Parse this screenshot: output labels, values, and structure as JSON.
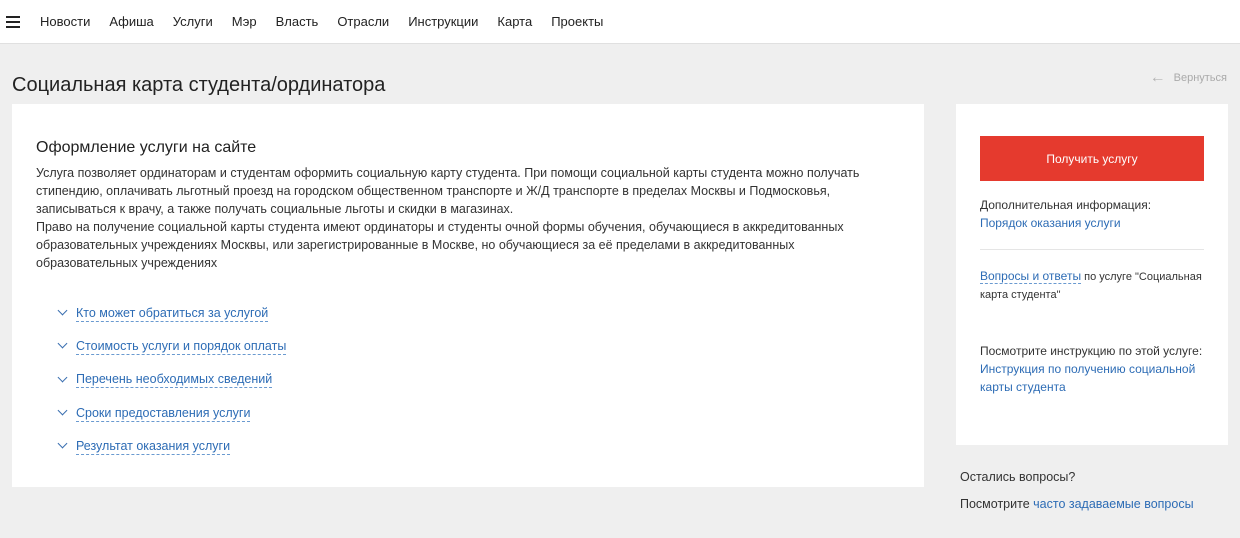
{
  "nav": {
    "items": [
      "Новости",
      "Афиша",
      "Услуги",
      "Мэр",
      "Власть",
      "Отрасли",
      "Инструкции",
      "Карта",
      "Проекты"
    ]
  },
  "page": {
    "title": "Социальная карта студента/ординатора",
    "back_label": "Вернуться"
  },
  "main": {
    "section_title": "Оформление услуги на сайте",
    "description": [
      "Услуга позволяет ординаторам и студентам оформить социальную карту студента. При помощи социальной карты студента можно получать",
      "стипендию, оплачивать льготный проезд на городском общественном транспорте и Ж/Д транспорте в пределах Москвы и Подмосковья,",
      "записываться к врачу, а также получать социальные льготы и скидки в магазинах.",
      "Право на получение социальной карты студента имеют ординаторы и студенты очной формы обучения, обучающиеся в аккредитованных",
      "образовательных учреждениях Москвы, или зарегистрированные в Москве, но обучающиеся за её пределами в аккредитованных",
      "образовательных учреждениях"
    ],
    "accordion": [
      "Кто может обратиться за услугой",
      "Стоимость услуги и порядок оплаты",
      "Перечень необходимых сведений",
      "Сроки предоставления услуги",
      "Результат оказания услуги"
    ]
  },
  "side": {
    "cta_label": "Получить услугу",
    "extra_info_label": "Дополнительная информация:",
    "order_link": "Порядок оказания услуги",
    "qa_link": "Вопросы и ответы",
    "qa_suffix": " по услуге \"Социальная",
    "qa_suffix2": "карта студента\"",
    "instruction_label": "Посмотрите инструкцию по этой услуге:",
    "instruction_link_1": "Инструкция по получению социальной",
    "instruction_link_2": "карты студента"
  },
  "footer": {
    "questions": "Остались вопросы?",
    "faq_prefix": "Посмотрите ",
    "faq_link": "часто задаваемые вопросы"
  },
  "colors": {
    "accent_red": "#e53a2e",
    "link_blue": "#2d6cb5",
    "background": "#efefef"
  }
}
